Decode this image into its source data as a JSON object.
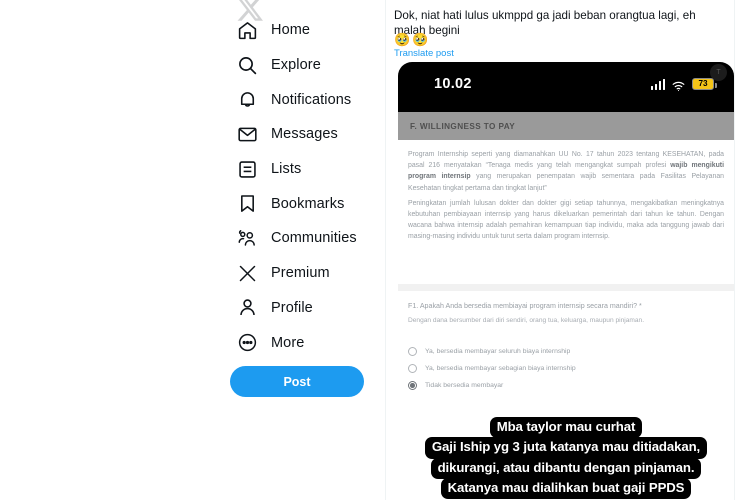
{
  "sidebar": {
    "logo": "x-logo",
    "items": [
      {
        "label": "Home",
        "icon": "home-icon"
      },
      {
        "label": "Explore",
        "icon": "search-icon"
      },
      {
        "label": "Notifications",
        "icon": "bell-icon"
      },
      {
        "label": "Messages",
        "icon": "envelope-icon"
      },
      {
        "label": "Lists",
        "icon": "list-icon"
      },
      {
        "label": "Bookmarks",
        "icon": "bookmark-icon"
      },
      {
        "label": "Communities",
        "icon": "communities-icon"
      },
      {
        "label": "Premium",
        "icon": "x-premium-icon"
      },
      {
        "label": "Profile",
        "icon": "person-icon"
      },
      {
        "label": "More",
        "icon": "more-circle-icon"
      }
    ],
    "post_button": "Post",
    "accent_color": "#1d9bf0"
  },
  "tweet": {
    "text": "Dok, niat hati lulus ukmppd ga jadi beban orangtua lagi, eh malah begini",
    "emojis": "🥹🥹",
    "translate_link": "Translate post"
  },
  "phone": {
    "status_bar": {
      "time": "10.02",
      "signal_icon": "cellular-signal-icon",
      "wifi_icon": "wifi-icon",
      "battery_level": "73",
      "battery_color": "#f5c518"
    },
    "section_header": "F. WILLINGNESS TO PAY",
    "paragraph_1_pre": "Program Internship seperti yang diamanahkan UU No. 17 tahun 2023 tentang KESEHATAN, pada pasal 216 menyatakan “Tenaga medis yang telah mengangkat sumpah profesi ",
    "paragraph_1_bold": "wajib mengikuti program internsip",
    "paragraph_1_post": " yang merupakan penempatan wajib sementara pada Fasilitas Pelayanan Kesehatan tingkat pertama dan tingkat lanjut”",
    "paragraph_2": "Peningkatan jumlah lulusan dokter dan dokter gigi setiap tahunnya, mengakibatkan meningkatnya kebutuhan pembiayaan internsip yang harus dikeluarkan pemerintah dari tahun ke tahun. Dengan wacana bahwa internsip adalah pemahiran kemampuan tiap individu, maka ada tanggung jawab dari masing-masing individu untuk turut serta dalam program internsip.",
    "question": {
      "title": "F1. Apakah Anda bersedia membiayai program internsip secara mandiri? *",
      "subtitle": "Dengan dana bersumber dari diri sendiri, orang tua, keluarga, maupun pinjaman.",
      "options": [
        {
          "label": "Ya, bersedia membayar seluruh biaya internship",
          "selected": false
        },
        {
          "label": "Ya, bersedia membayar sebagian biaya internship",
          "selected": false
        },
        {
          "label": "Tidak bersedia membayar",
          "selected": true
        }
      ]
    },
    "caption_lines": [
      "Mba taylor mau curhat",
      "Gaji Iship yg 3 juta katanya mau ditiadakan,",
      "dikurangi, atau dibantu dengan pinjaman.",
      "Katanya mau dialihkan buat gaji PPDS"
    ]
  }
}
